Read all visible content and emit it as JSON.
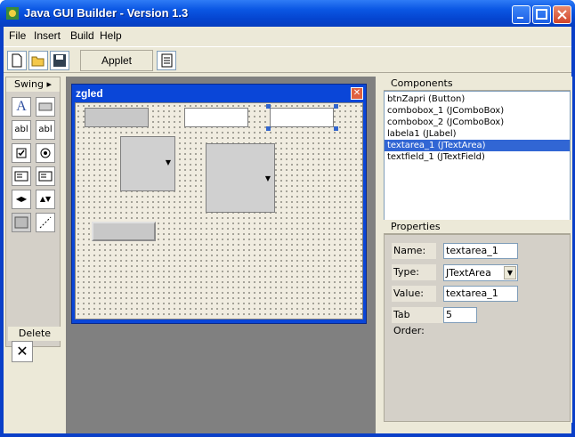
{
  "window": {
    "title": "Java GUI Builder - Version 1.3"
  },
  "menu": [
    "File",
    "Insert",
    "Build",
    "Help"
  ],
  "toolbar": {
    "applet_label": "Applet"
  },
  "palette": {
    "header": "Swing",
    "delete_label": "Delete"
  },
  "frame": {
    "title": "zgled"
  },
  "components": {
    "header": "Components",
    "items": [
      "btnZapri (Button)",
      "combobox_1 (JComboBox)",
      "combobox_2 (JComboBox)",
      "labela1 (JLabel)",
      "textarea_1 (JTextArea)",
      "textfield_1 (JTextField)"
    ],
    "selected": "textarea_1 (JTextArea)"
  },
  "properties": {
    "header": "Properties",
    "name_label": "Name:",
    "name_value": "textarea_1",
    "type_label": "Type:",
    "type_value": "JTextArea",
    "value_label": "Value:",
    "value_value": "textarea_1",
    "taborder_label": "Tab Order:",
    "taborder_value": "5"
  }
}
